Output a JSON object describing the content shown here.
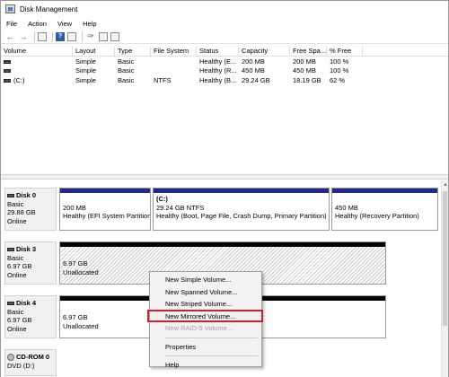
{
  "window": {
    "title": "Disk Management"
  },
  "menu": [
    "File",
    "Action",
    "View",
    "Help"
  ],
  "toolbar": {
    "icons": [
      "back-arrow-icon",
      "forward-arrow-icon",
      "console-tree-icon",
      "properties-icon",
      "help-icon",
      "rescan-icon",
      "disk-list-icon",
      "settings-icon"
    ]
  },
  "volume_table": {
    "headers": [
      "Volume",
      "Layout",
      "Type",
      "File System",
      "Status",
      "Capacity",
      "Free Spa...",
      "% Free"
    ],
    "rows": [
      {
        "volume": "",
        "layout": "Simple",
        "type": "Basic",
        "fs": "",
        "status": "Healthy (E...",
        "capacity": "200 MB",
        "free": "200 MB",
        "pct": "100 %"
      },
      {
        "volume": "",
        "layout": "Simple",
        "type": "Basic",
        "fs": "",
        "status": "Healthy (R...",
        "capacity": "450 MB",
        "free": "450 MB",
        "pct": "100 %"
      },
      {
        "volume": "(C:)",
        "layout": "Simple",
        "type": "Basic",
        "fs": "NTFS",
        "status": "Healthy (B...",
        "capacity": "29.24 GB",
        "free": "18.19 GB",
        "pct": "62 %"
      }
    ]
  },
  "disks": [
    {
      "name": "Disk 0",
      "type": "Basic",
      "size": "29.88 GB",
      "status": "Online",
      "partitions": [
        {
          "label": "",
          "size": "200 MB",
          "status": "Healthy (EFI System Partition)"
        },
        {
          "label": "(C:)",
          "size": "29.24 GB NTFS",
          "status": "Healthy (Boot, Page File, Crash Dump, Primary Partition)"
        },
        {
          "label": "",
          "size": "450 MB",
          "status": "Healthy (Recovery Partition)"
        }
      ]
    },
    {
      "name": "Disk 3",
      "type": "Basic",
      "size": "6.97 GB",
      "status": "Online",
      "partitions": [
        {
          "size": "6.97 GB",
          "status": "Unallocated"
        }
      ]
    },
    {
      "name": "Disk 4",
      "type": "Basic",
      "size": "6.97 GB",
      "status": "Online",
      "partitions": [
        {
          "size": "6.97 GB",
          "status": "Unallocated"
        }
      ]
    },
    {
      "name": "CD-ROM 0",
      "type": "DVD (D:)"
    }
  ],
  "context_menu": {
    "items": [
      {
        "label": "New Simple Volume...",
        "enabled": true
      },
      {
        "label": "New Spanned Volume...",
        "enabled": true
      },
      {
        "label": "New Striped Volume...",
        "enabled": true
      },
      {
        "label": "New Mirrored Volume...",
        "enabled": true,
        "highlighted": true
      },
      {
        "label": "New RAID-5 Volume...",
        "enabled": false
      },
      {
        "label": "Properties",
        "enabled": true
      },
      {
        "label": "Help",
        "enabled": true
      }
    ]
  },
  "colors": {
    "primary_partition_bar": "#1f2a85",
    "unallocated_bar": "#000000",
    "highlight_border": "#d02030"
  }
}
